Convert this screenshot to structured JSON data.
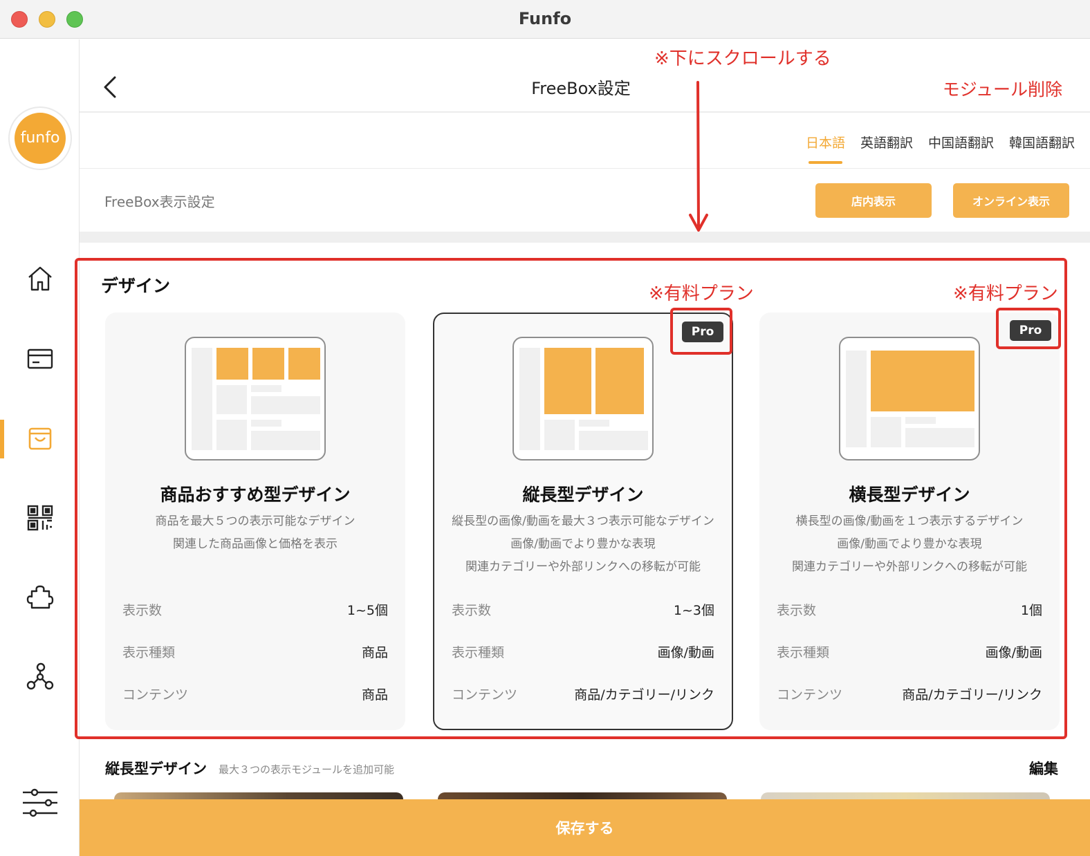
{
  "window": {
    "title": "Funfo"
  },
  "sidebar": {
    "logo_text": "funfo",
    "items": [
      {
        "name": "home-icon"
      },
      {
        "name": "card-icon"
      },
      {
        "name": "shop-bag-icon",
        "active": true
      },
      {
        "name": "qr-code-icon"
      },
      {
        "name": "puzzle-icon"
      },
      {
        "name": "share-network-icon"
      },
      {
        "name": "sliders-icon"
      }
    ]
  },
  "header": {
    "title": "FreeBox設定"
  },
  "language_tabs": [
    {
      "label": "日本語",
      "active": true
    },
    {
      "label": "英語翻訳"
    },
    {
      "label": "中国語翻訳"
    },
    {
      "label": "韓国語翻訳"
    }
  ],
  "display_settings": {
    "label": "FreeBox表示設定",
    "store_button": "店内表示",
    "online_button": "オンライン表示"
  },
  "design": {
    "section_title": "デザイン",
    "cards": [
      {
        "title": "商品おすすめ型デザイン",
        "desc": [
          "商品を最大５つの表示可能なデザイン",
          "関連した商品画像と価格を表示"
        ],
        "pro": false,
        "selected": false,
        "rows": [
          {
            "key": "表示数",
            "value": "1~5個"
          },
          {
            "key": "表示種類",
            "value": "商品"
          },
          {
            "key": "コンテンツ",
            "value": "商品"
          }
        ]
      },
      {
        "title": "縦長型デザイン",
        "desc": [
          "縦長型の画像/動画を最大３つ表示可能なデザイン",
          "画像/動画でより豊かな表現",
          "関連カテゴリーや外部リンクへの移転が可能"
        ],
        "pro": true,
        "pro_label": "Pro",
        "selected": true,
        "rows": [
          {
            "key": "表示数",
            "value": "1~3個"
          },
          {
            "key": "表示種類",
            "value": "画像/動画"
          },
          {
            "key": "コンテンツ",
            "value": "商品/カテゴリー/リンク"
          }
        ]
      },
      {
        "title": "横長型デザイン",
        "desc": [
          "横長型の画像/動画を１つ表示するデザイン",
          "画像/動画でより豊かな表現",
          "関連カテゴリーや外部リンクへの移転が可能"
        ],
        "pro": true,
        "pro_label": "Pro",
        "selected": false,
        "rows": [
          {
            "key": "表示数",
            "value": "1個"
          },
          {
            "key": "表示種類",
            "value": "画像/動画"
          },
          {
            "key": "コンテンツ",
            "value": "商品/カテゴリー/リンク"
          }
        ]
      }
    ]
  },
  "module_section": {
    "title": "縦長型デザイン",
    "note": "最大３つの表示モジュールを追加可能",
    "edit": "編集"
  },
  "save_button": "保存する",
  "annotations": {
    "scroll_note": "※下にスクロールする",
    "delete_note": "モジュール削除",
    "paid_note": "※有料プラン"
  },
  "colors": {
    "accent": "#f3a935",
    "annotation": "#e0302a",
    "pro_badge": "#3a3a3a"
  }
}
